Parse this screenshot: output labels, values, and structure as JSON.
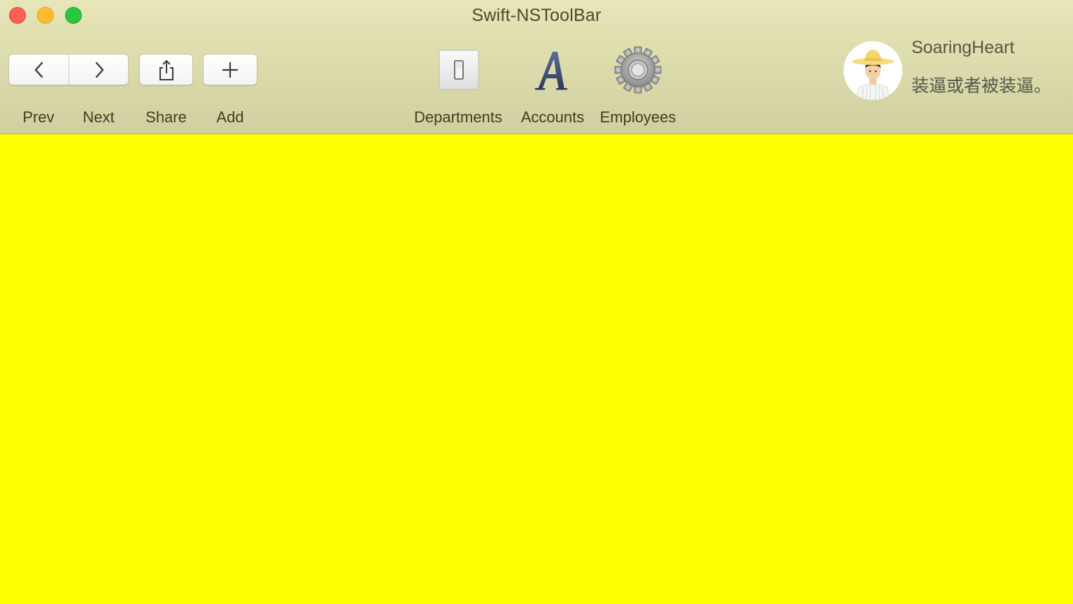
{
  "window": {
    "title": "Swift-NSToolBar"
  },
  "toolbar": {
    "items": [
      {
        "label": "Prev",
        "icon": "chevron-left-icon"
      },
      {
        "label": "Next",
        "icon": "chevron-right-icon"
      },
      {
        "label": "Share",
        "icon": "share-icon"
      },
      {
        "label": "Add",
        "icon": "plus-icon"
      },
      {
        "label": "Departments",
        "icon": "light-switch-icon"
      },
      {
        "label": "Accounts",
        "icon": "font-a-icon"
      },
      {
        "label": "Employees",
        "icon": "gear-icon"
      }
    ]
  },
  "user": {
    "name": "SoaringHeart",
    "motto": "装逼或者被装逼。",
    "avatar_icon": "avatar-straw-hat-icon"
  },
  "colors": {
    "toolbar_bg": "#dcdcac",
    "content_bg": "#ffff00",
    "close": "#fe5f57",
    "minimize": "#febc2e",
    "maximize": "#28c840"
  }
}
